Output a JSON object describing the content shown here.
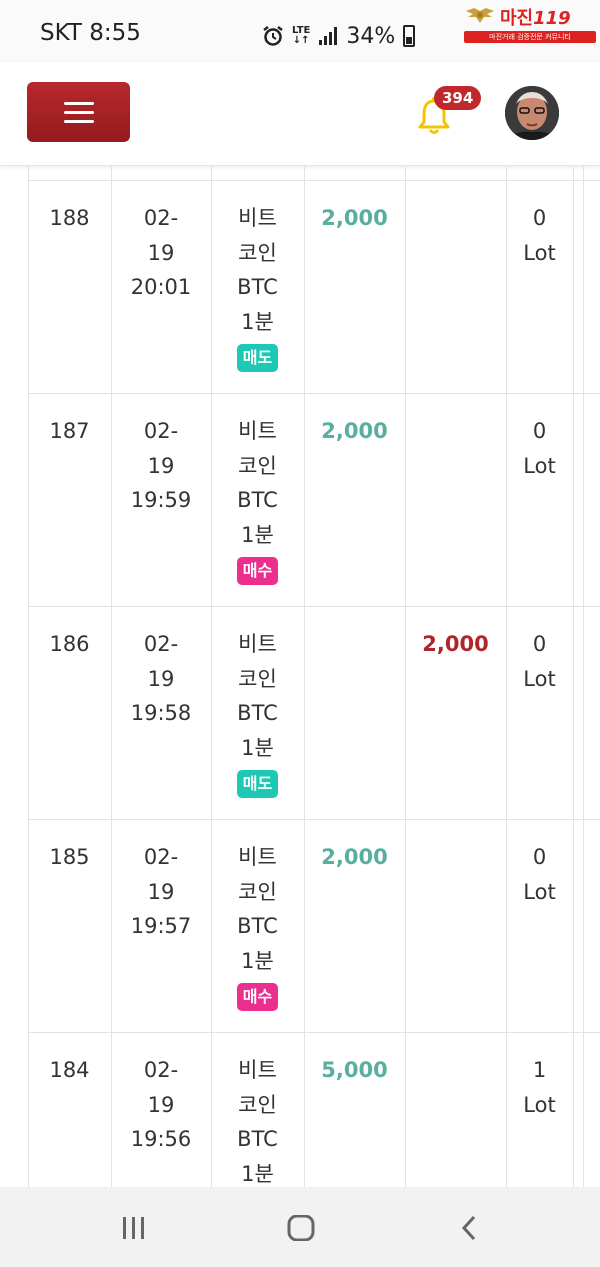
{
  "status_bar": {
    "carrier_time": "SKT 8:55",
    "network": "LTE",
    "battery": "34%",
    "icons": [
      "alarm-icon",
      "lte-icon",
      "signal-icon",
      "battery-icon"
    ]
  },
  "watermark": {
    "name": "마진",
    "number": "119",
    "tagline": "마진거래 검증전문 커뮤니티"
  },
  "header": {
    "notification_count": "394",
    "colors": {
      "menu_button": "#a82226",
      "bell": "#f5c400",
      "badge": "#c0282c"
    }
  },
  "trade_rows": [
    {
      "no": "188",
      "date": "02-",
      "day": "19",
      "time": "20:01",
      "item_line1": "비트",
      "item_line2": "코인",
      "item_line3": "BTC",
      "item_line4": "1분",
      "side": "매도",
      "side_type": "sell",
      "buy_amount": "2,000",
      "sell_amount": "",
      "lot_value": "0",
      "lot_unit": "Lot"
    },
    {
      "no": "187",
      "date": "02-",
      "day": "19",
      "time": "19:59",
      "item_line1": "비트",
      "item_line2": "코인",
      "item_line3": "BTC",
      "item_line4": "1분",
      "side": "매수",
      "side_type": "buy",
      "buy_amount": "2,000",
      "sell_amount": "",
      "lot_value": "0",
      "lot_unit": "Lot"
    },
    {
      "no": "186",
      "date": "02-",
      "day": "19",
      "time": "19:58",
      "item_line1": "비트",
      "item_line2": "코인",
      "item_line3": "BTC",
      "item_line4": "1분",
      "side": "매도",
      "side_type": "sell",
      "buy_amount": "",
      "sell_amount": "2,000",
      "lot_value": "0",
      "lot_unit": "Lot"
    },
    {
      "no": "185",
      "date": "02-",
      "day": "19",
      "time": "19:57",
      "item_line1": "비트",
      "item_line2": "코인",
      "item_line3": "BTC",
      "item_line4": "1분",
      "side": "매수",
      "side_type": "buy",
      "buy_amount": "2,000",
      "sell_amount": "",
      "lot_value": "0",
      "lot_unit": "Lot"
    },
    {
      "no": "184",
      "date": "02-",
      "day": "19",
      "time": "19:56",
      "item_line1": "비트",
      "item_line2": "코인",
      "item_line3": "BTC",
      "item_line4": "1분",
      "side": "",
      "side_type": "",
      "buy_amount": "5,000",
      "sell_amount": "",
      "lot_value": "1",
      "lot_unit": "Lot"
    }
  ],
  "colors": {
    "buy_amount": "#5aaea0",
    "sell_amount": "#b0262a",
    "tag_sell": "#1dc9b4",
    "tag_buy": "#ec2f8f"
  },
  "nav_bar": {
    "icons": [
      "recent-apps-icon",
      "home-icon",
      "back-icon"
    ]
  }
}
